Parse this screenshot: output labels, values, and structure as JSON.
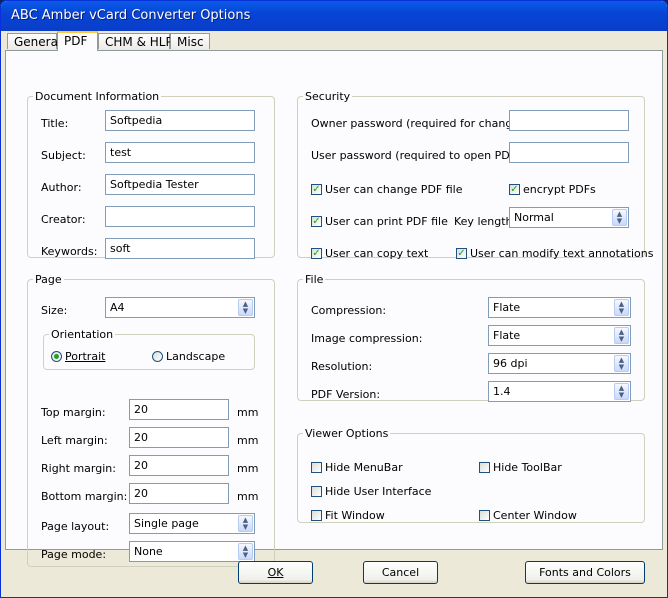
{
  "window": {
    "title": "ABC Amber vCard Converter Options"
  },
  "tabs": [
    {
      "label": "General"
    },
    {
      "label": "PDF"
    },
    {
      "label": "CHM & HLP"
    },
    {
      "label": "Misc"
    }
  ],
  "document_info": {
    "legend": "Document Information",
    "title_label": "Title:",
    "title_value": "Softpedia",
    "subject_label": "Subject:",
    "subject_value": "test",
    "author_label": "Author:",
    "author_value": "Softpedia Tester",
    "creator_label": "Creator:",
    "creator_value": "",
    "keywords_label": "Keywords:",
    "keywords_value": "soft"
  },
  "page": {
    "legend": "Page",
    "size_label": "Size:",
    "size_value": "A4",
    "orientation_legend": "Orientation",
    "portrait_label": "Portrait",
    "landscape_label": "Landscape",
    "top_margin_label": "Top margin:",
    "top_margin_value": "20",
    "left_margin_label": "Left margin:",
    "left_margin_value": "20",
    "right_margin_label": "Right margin:",
    "right_margin_value": "20",
    "bottom_margin_label": "Bottom margin:",
    "bottom_margin_value": "20",
    "unit": "mm",
    "layout_label": "Page layout:",
    "layout_value": "Single page",
    "mode_label": "Page mode:",
    "mode_value": "None"
  },
  "security": {
    "legend": "Security",
    "owner_password_label": "Owner password (required for changes):",
    "owner_password_value": "",
    "user_password_label": "User password (required to open PDF):",
    "user_password_value": "",
    "change_pdf_label": "User can change PDF file",
    "encrypt_label": "encrypt PDFs",
    "print_label": "User can print PDF file",
    "key_length_label": "Key length:",
    "key_length_value": "Normal",
    "copy_text_label": "User can copy text",
    "modify_annotations_label": "User can modify text annotations"
  },
  "file": {
    "legend": "File",
    "compression_label": "Compression:",
    "compression_value": "Flate",
    "image_compression_label": "Image compression:",
    "image_compression_value": "Flate",
    "resolution_label": "Resolution:",
    "resolution_value": "96 dpi",
    "pdf_version_label": "PDF Version:",
    "pdf_version_value": "1.4"
  },
  "viewer": {
    "legend": "Viewer Options",
    "hide_menubar_label": "Hide MenuBar",
    "hide_toolbar_label": "Hide ToolBar",
    "hide_ui_label": "Hide User Interface",
    "fit_window_label": "Fit Window",
    "center_window_label": "Center Window"
  },
  "buttons": {
    "ok_label": "OK",
    "cancel_label": "Cancel",
    "fonts_colors_label": "Fonts and Colors"
  },
  "icons": {
    "combo_arrow": "chevron-up-down-icon",
    "check": "checkmark-icon"
  }
}
